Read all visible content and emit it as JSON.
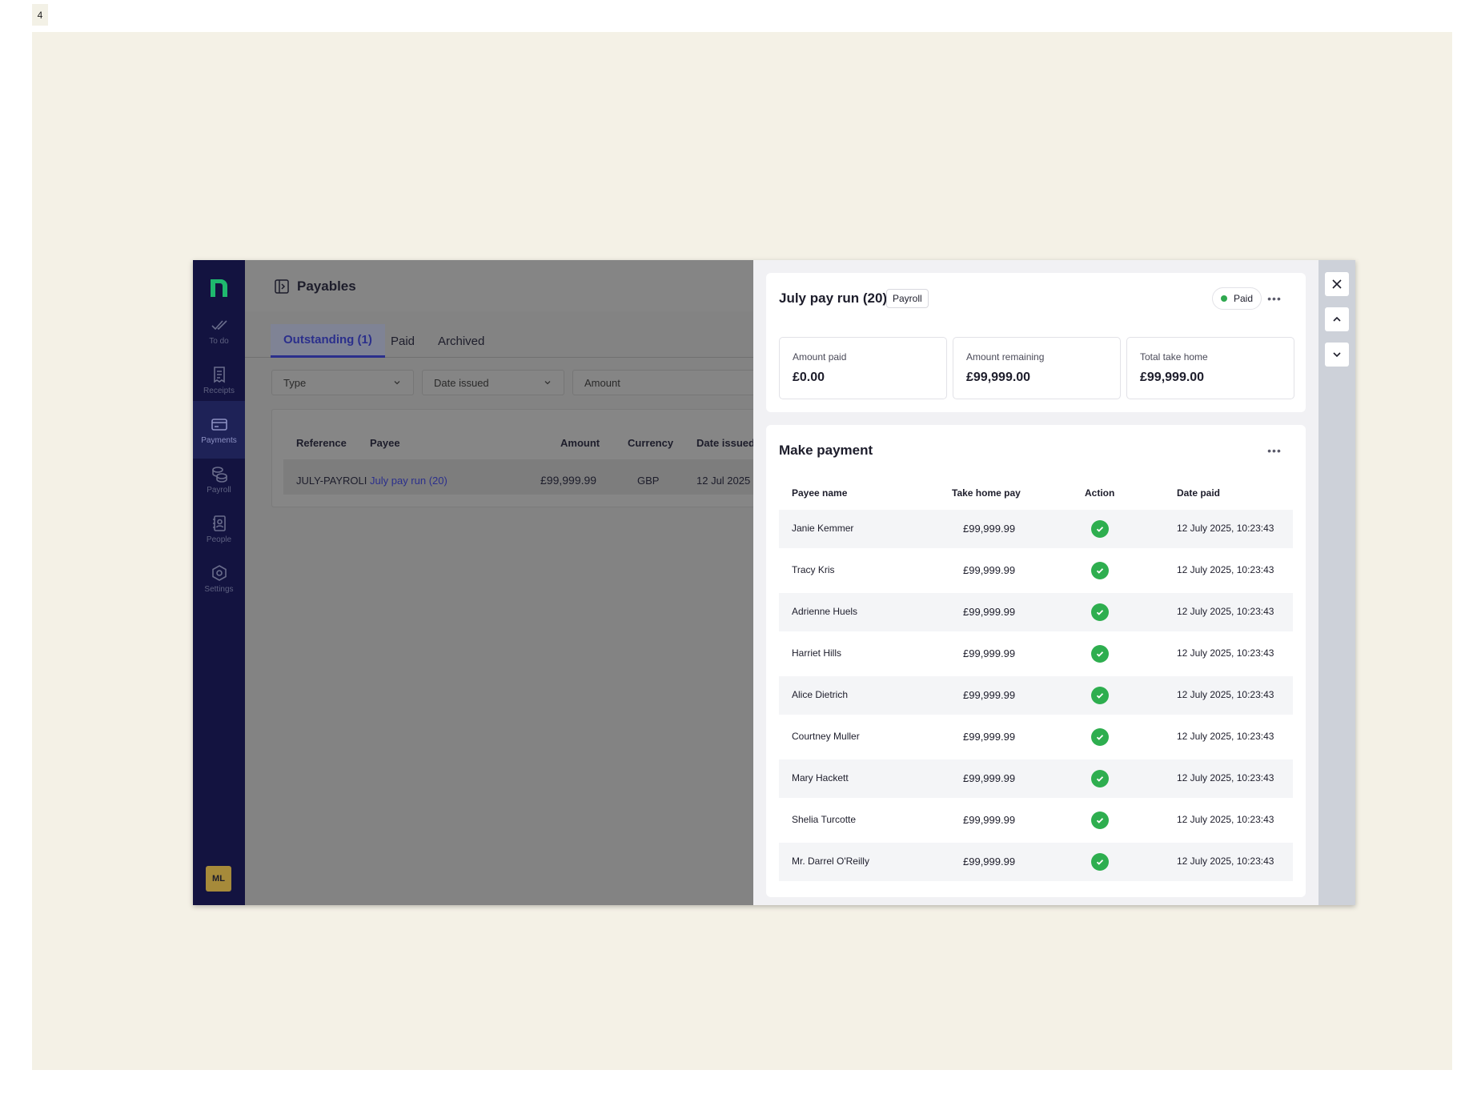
{
  "page_label": "4",
  "sidebar": {
    "items": [
      {
        "label": "To do",
        "icon": "double-check-icon"
      },
      {
        "label": "Receipts",
        "icon": "receipt-icon"
      },
      {
        "label": "Payments",
        "icon": "card-icon"
      },
      {
        "label": "Payroll",
        "icon": "coins-icon"
      },
      {
        "label": "People",
        "icon": "contacts-icon"
      },
      {
        "label": "Settings",
        "icon": "gear-icon"
      }
    ],
    "active": "Payments",
    "avatar_initials": "ML",
    "brand_color": "#1fb86e"
  },
  "main": {
    "title": "Payables",
    "tabs": [
      "Outstanding (1)",
      "Paid",
      "Archived"
    ],
    "filters": [
      "Type",
      "Date issued",
      "Amount"
    ],
    "table": {
      "headers": [
        "Reference",
        "Payee",
        "Amount",
        "Currency",
        "Date issued"
      ],
      "rows": [
        {
          "reference": "JULY-PAYROLI",
          "payee": "July pay run (20)",
          "amount": "£99,999.99",
          "currency": "GBP",
          "date_issued": "12 Jul 2025"
        }
      ]
    }
  },
  "drawer": {
    "title": "July pay run (20)",
    "tag": "Payroll",
    "status": "Paid",
    "stats": [
      {
        "label": "Amount paid",
        "value": "£0.00"
      },
      {
        "label": "Amount remaining",
        "value": "£99,999.00"
      },
      {
        "label": "Total take home",
        "value": "£99,999.00"
      }
    ],
    "make_payment": {
      "title": "Make payment",
      "headers": [
        "Payee name",
        "Take home pay",
        "Action",
        "Date paid"
      ],
      "rows": [
        {
          "name": "Janie Kemmer",
          "pay": "£99,999.99",
          "date": "12 July 2025, 10:23:43"
        },
        {
          "name": "Tracy Kris",
          "pay": "£99,999.99",
          "date": "12 July 2025, 10:23:43"
        },
        {
          "name": "Adrienne Huels",
          "pay": "£99,999.99",
          "date": "12 July 2025, 10:23:43"
        },
        {
          "name": "Harriet Hills",
          "pay": "£99,999.99",
          "date": "12 July 2025, 10:23:43"
        },
        {
          "name": "Alice Dietrich",
          "pay": "£99,999.99",
          "date": "12 July 2025, 10:23:43"
        },
        {
          "name": "Courtney Muller",
          "pay": "£99,999.99",
          "date": "12 July 2025, 10:23:43"
        },
        {
          "name": "Mary Hackett",
          "pay": "£99,999.99",
          "date": "12 July 2025, 10:23:43"
        },
        {
          "name": "Shelia Turcotte",
          "pay": "£99,999.99",
          "date": "12 July 2025, 10:23:43"
        },
        {
          "name": "Mr. Darrel O'Reilly",
          "pay": "£99,999.99",
          "date": "12 July 2025, 10:23:43"
        }
      ]
    }
  },
  "colors": {
    "sidebar_bg": "#131340",
    "accent": "#2b2f8c",
    "success": "#2eae4f",
    "canvas": "#f4f1e6"
  }
}
